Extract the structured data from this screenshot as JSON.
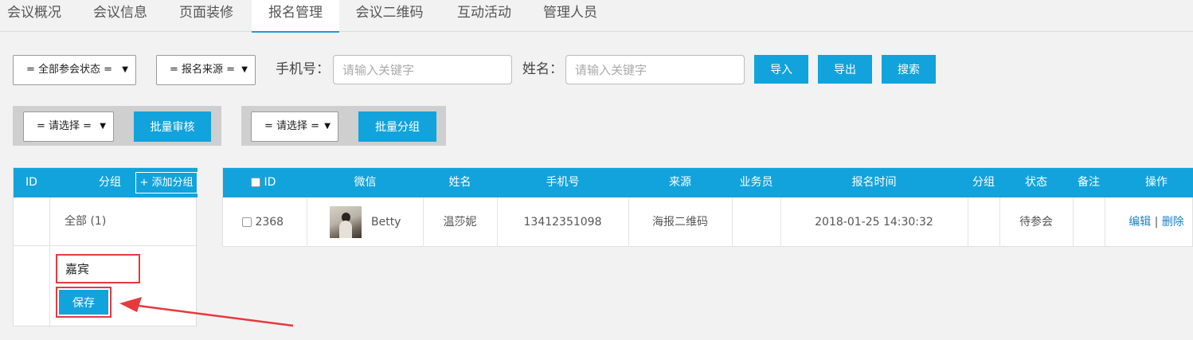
{
  "tabs": [
    {
      "label": "会议概况"
    },
    {
      "label": "会议信息"
    },
    {
      "label": "页面装修"
    },
    {
      "label": "报名管理"
    },
    {
      "label": "会议二维码"
    },
    {
      "label": "互动活动"
    },
    {
      "label": "管理人员"
    }
  ],
  "active_tab": "报名管理",
  "filters": {
    "status_select": "= 全部参会状态 =",
    "source_select": "= 报名来源 =",
    "phone_label": "手机号：",
    "phone_placeholder": "请输入关键字",
    "name_label": "姓名：",
    "name_placeholder": "请输入关键字",
    "import_label": "导入",
    "export_label": "导出",
    "search_label": "搜索"
  },
  "batch": {
    "audit_select": "= 请选择 =",
    "audit_button": "批量审核",
    "group_select": "= 请选择 =",
    "group_button": "批量分组"
  },
  "group_table": {
    "col_id": "ID",
    "col_group": "分组",
    "add_group_label": "+ 添加分组",
    "all_row": "全部 (1)",
    "new_group_value": "嘉宾",
    "save_label": "保存"
  },
  "main_table": {
    "headers": [
      "ID",
      "微信",
      "姓名",
      "手机号",
      "来源",
      "业务员",
      "报名时间",
      "分组",
      "状态",
      "备注",
      "操作"
    ],
    "row": {
      "id": "2368",
      "wechat": "Betty",
      "name": "温莎妮",
      "phone": "13412351098",
      "source": "海报二维码",
      "salesman": "",
      "time": "2018-01-25 14:30:32",
      "group": "",
      "status": "待参会",
      "note": "",
      "edit": "编辑",
      "sep": "|",
      "delete": "删除"
    }
  },
  "colors": {
    "accent": "#12a3dc",
    "annotation": "#e8393e"
  }
}
